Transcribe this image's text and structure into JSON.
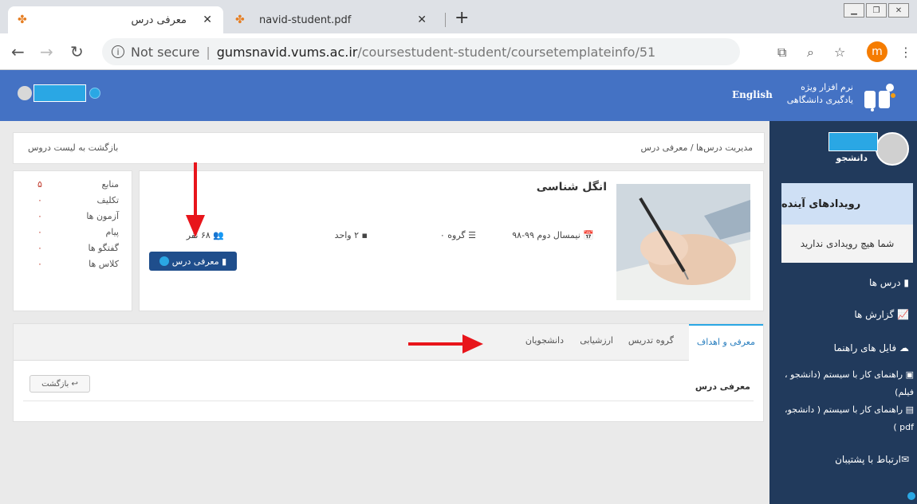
{
  "browser": {
    "tabs": [
      {
        "title": "معرفی درس",
        "favicon": "navid-icon",
        "active": true
      },
      {
        "title": "navid-student.pdf",
        "favicon": "navid-icon",
        "active": false
      }
    ],
    "url_security": "Not secure",
    "url_host": "gumsnavid.vums.ac.ir",
    "url_path": "/coursestudent-student/coursetemplateinfo/51",
    "profile_initial": "m"
  },
  "header": {
    "logo_line1": "نرم افزار ویژه",
    "logo_line2": "یادگیری دانشگاهی",
    "language_link": "English"
  },
  "breadcrumb": {
    "text": "مدیریت درس‌ها / معرفی درس",
    "back_to_list": "بازگشت به لیست دروس"
  },
  "stats": [
    {
      "label": "منابع",
      "value": "۵"
    },
    {
      "label": "تکلیف",
      "value": "۰"
    },
    {
      "label": "آزمون ها",
      "value": "۰"
    },
    {
      "label": "پیام",
      "value": "۰"
    },
    {
      "label": "گفتگو ها",
      "value": "۰"
    },
    {
      "label": "کلاس ها",
      "value": "۰"
    }
  ],
  "course": {
    "title": "انگل شناسی",
    "semester": "نیمسال دوم ۹۹-۹۸",
    "group": "گروه ۰",
    "units": "۲ واحد",
    "students": "۶۸ نفر",
    "intro_button": "معرفی درس"
  },
  "course_tabs": [
    {
      "label": "معرفی و اهداف",
      "active": true
    },
    {
      "label": "گروه تدریس",
      "active": false
    },
    {
      "label": "ارزشیابی",
      "active": false
    },
    {
      "label": "دانشجویان",
      "active": false
    }
  ],
  "tab_content": {
    "title": "معرفی درس",
    "back_button": "بازگشت"
  },
  "sidebar": {
    "role": "دانشجو",
    "events_title": "رویدادهای آینده",
    "events_empty": "شما هیچ رویدادی ندارید",
    "menu": [
      {
        "label": "درس ها",
        "icon": "book-icon"
      },
      {
        "label": "گزارش ها",
        "icon": "chart-icon"
      },
      {
        "label": "فایل های راهنما",
        "icon": "cloud-download-icon"
      }
    ],
    "guides": [
      {
        "label": "راهنمای کار با سیستم (دانشجو ، فیلم)",
        "icon": "film-icon"
      },
      {
        "label": "راهنمای کار با سیستم ( دانشجو، pdf )",
        "icon": "file-icon"
      }
    ],
    "support": "ارتباط با پشتیبان"
  },
  "colors": {
    "header_blue": "#4472c4",
    "sidebar_navy": "#213a5c",
    "accent_cyan": "#2aa7e4",
    "annotation_red": "#e8151b"
  }
}
